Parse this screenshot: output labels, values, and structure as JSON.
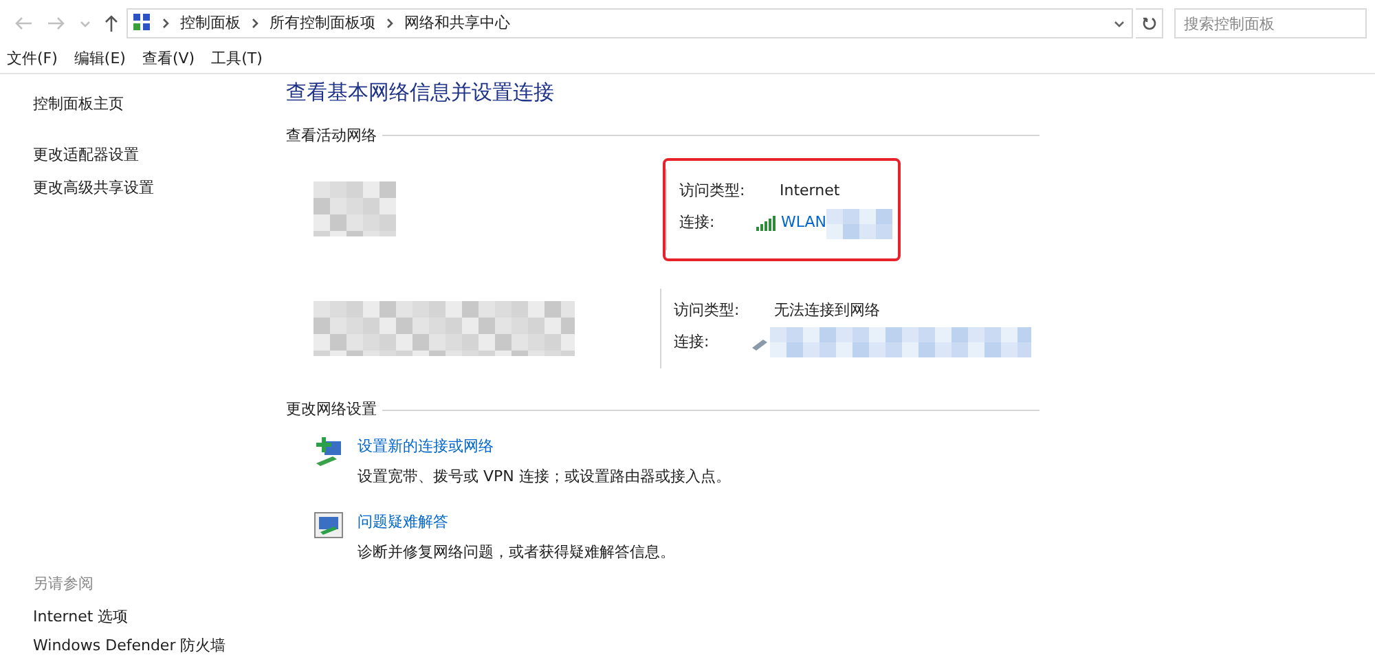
{
  "address_bar": {
    "breadcrumbs": [
      "控制面板",
      "所有控制面板项",
      "网络和共享中心"
    ]
  },
  "search": {
    "placeholder": "搜索控制面板"
  },
  "menu": [
    "文件(F)",
    "编辑(E)",
    "查看(V)",
    "工具(T)"
  ],
  "sidebar": {
    "items": [
      "控制面板主页",
      "更改适配器设置",
      "更改高级共享设置"
    ],
    "see_also": {
      "heading": "另请参阅",
      "items": [
        "Internet 选项",
        "Windows Defender 防火墙"
      ]
    }
  },
  "title": "查看基本网络信息并设置连接",
  "active_networks": {
    "heading": "查看活动网络",
    "networks": [
      {
        "highlighted": true,
        "access_label": "访问类型:",
        "access": "Internet",
        "connection_label": "连接:",
        "kind": "wifi",
        "connection": "WLAN"
      },
      {
        "highlighted": false,
        "access_label": "访问类型:",
        "access": "无法连接到网络",
        "connection_label": "连接:",
        "kind": "ethernet"
      }
    ]
  },
  "change_settings": {
    "heading": "更改网络设置",
    "items": [
      {
        "kind": "new-connection",
        "link": "设置新的连接或网络",
        "description": "设置宽带、拨号或 VPN 连接；或设置路由器或接入点。"
      },
      {
        "kind": "troubleshoot",
        "link": "问题疑难解答",
        "description": "诊断并修复网络问题，或者获得疑难解答信息。"
      }
    ]
  }
}
